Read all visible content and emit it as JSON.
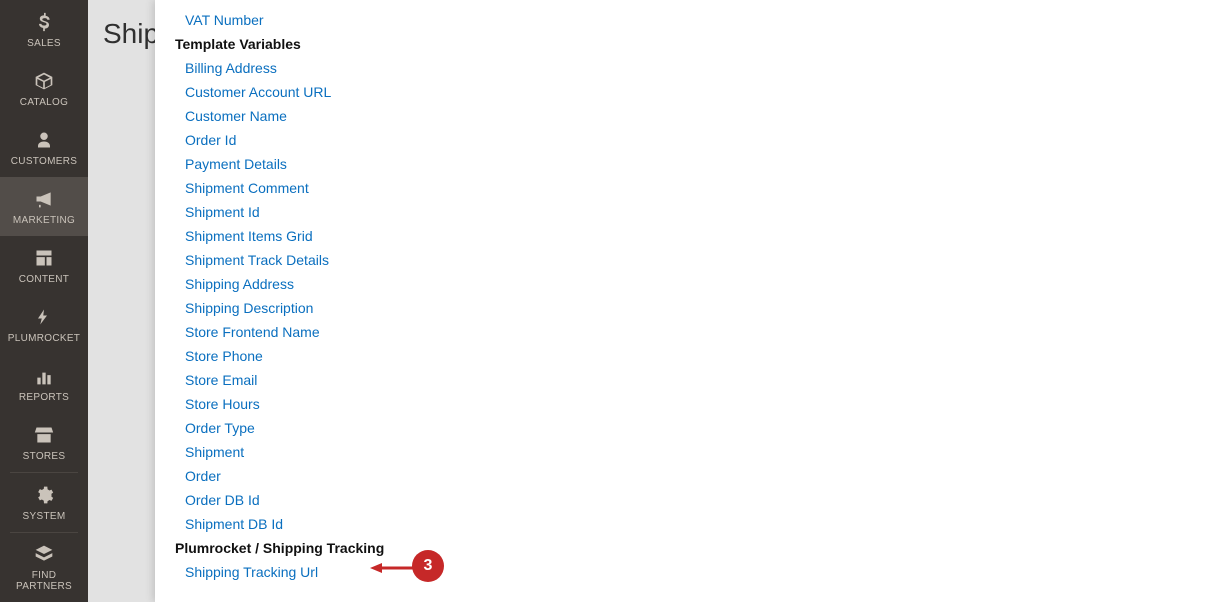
{
  "sidebar": {
    "items": [
      {
        "label": "SALES"
      },
      {
        "label": "CATALOG"
      },
      {
        "label": "CUSTOMERS"
      },
      {
        "label": "MARKETING"
      },
      {
        "label": "CONTENT"
      },
      {
        "label": "PLUMROCKET"
      },
      {
        "label": "REPORTS"
      },
      {
        "label": "STORES"
      },
      {
        "label": "SYSTEM"
      },
      {
        "label": "FIND PARTNERS"
      }
    ]
  },
  "page": {
    "title": "Ship"
  },
  "modal": {
    "items": [
      {
        "type": "link",
        "label": "VAT Number"
      },
      {
        "type": "section",
        "label": "Template Variables"
      },
      {
        "type": "link",
        "label": "Billing Address"
      },
      {
        "type": "link",
        "label": "Customer Account URL"
      },
      {
        "type": "link",
        "label": "Customer Name"
      },
      {
        "type": "link",
        "label": "Order Id"
      },
      {
        "type": "link",
        "label": "Payment Details"
      },
      {
        "type": "link",
        "label": "Shipment Comment"
      },
      {
        "type": "link",
        "label": "Shipment Id"
      },
      {
        "type": "link",
        "label": "Shipment Items Grid"
      },
      {
        "type": "link",
        "label": "Shipment Track Details"
      },
      {
        "type": "link",
        "label": "Shipping Address"
      },
      {
        "type": "link",
        "label": "Shipping Description"
      },
      {
        "type": "link",
        "label": "Store Frontend Name"
      },
      {
        "type": "link",
        "label": "Store Phone"
      },
      {
        "type": "link",
        "label": "Store Email"
      },
      {
        "type": "link",
        "label": "Store Hours"
      },
      {
        "type": "link",
        "label": "Order Type"
      },
      {
        "type": "link",
        "label": "Shipment"
      },
      {
        "type": "link",
        "label": "Order"
      },
      {
        "type": "link",
        "label": "Order DB Id"
      },
      {
        "type": "link",
        "label": "Shipment DB Id"
      },
      {
        "type": "section",
        "label": "Plumrocket / Shipping Tracking"
      },
      {
        "type": "link",
        "label": "Shipping Tracking Url"
      }
    ]
  },
  "annotation": {
    "badge": "3"
  }
}
